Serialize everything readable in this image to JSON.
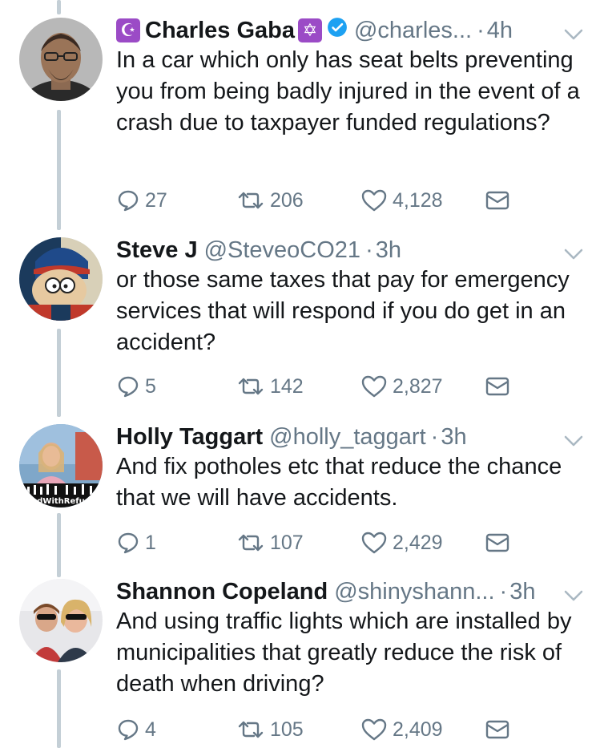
{
  "tweets": [
    {
      "name": "Charles Gaba",
      "handle": "@charles...",
      "time": "4h",
      "text": "In a car which only has seat belts preventing you from being badly injured in the event of a crash due to taxpayer funded regulations?",
      "replies": "27",
      "retweets": "206",
      "likes": "4,128",
      "verified": true,
      "badge_left": "☪",
      "badge_right": "✡"
    },
    {
      "name": "Steve J",
      "handle": "@SteveoCO21",
      "time": "3h",
      "text": "or those same taxes that pay for emergency services that will respond if you do get in an accident?",
      "replies": "5",
      "retweets": "142",
      "likes": "2,827"
    },
    {
      "name": "Holly Taggart",
      "handle": "@holly_taggart",
      "time": "3h",
      "text": "And fix potholes etc that reduce the chance that we will have accidents.",
      "replies": "1",
      "retweets": "107",
      "likes": "2,429",
      "avatar_text": "dWithRefu"
    },
    {
      "name": "Shannon Copeland",
      "handle": "@shinyshann...",
      "time": "3h",
      "text": "And using traffic lights which are installed by municipalities that greatly reduce the risk of death when driving?",
      "replies": "4",
      "retweets": "105",
      "likes": "2,409"
    }
  ],
  "colors": {
    "text": "#14171a",
    "muted": "#657786",
    "verified": "#1da1f2",
    "badge": "#9b4bc6",
    "thread_line": "#c4cfd6"
  },
  "icons": [
    "reply-icon",
    "retweet-icon",
    "like-icon",
    "direct-message-icon",
    "chevron-down-icon",
    "verified-icon"
  ]
}
